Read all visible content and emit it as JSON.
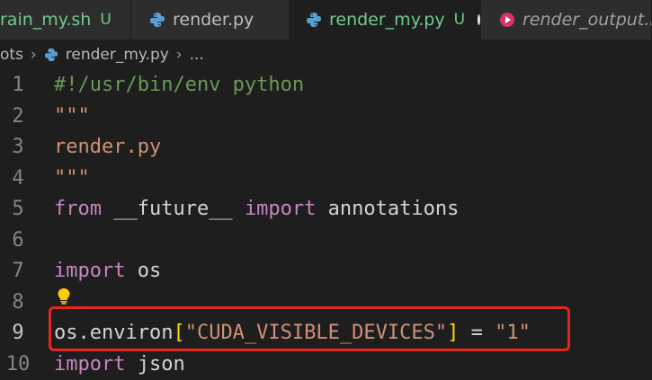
{
  "tabs": [
    {
      "label": "rain_my.sh",
      "badge": "U",
      "icon": "none",
      "state": "untracked"
    },
    {
      "label": "render.py",
      "icon": "python-icon"
    },
    {
      "label": "render_my.py",
      "badge": "U",
      "icon": "python-icon",
      "state": "active-modified"
    },
    {
      "label": "render_output.mp",
      "icon": "media-play-icon",
      "state": "preview"
    }
  ],
  "breadcrumb": {
    "parts": [
      "ots",
      "render_my.py",
      "..."
    ]
  },
  "editor": {
    "lines": [
      {
        "num": "1",
        "tokens": [
          {
            "t": "#!/usr/bin/env python",
            "k": "comment"
          }
        ]
      },
      {
        "num": "2",
        "tokens": [
          {
            "t": "\"\"\"",
            "k": "string"
          }
        ]
      },
      {
        "num": "3",
        "tokens": [
          {
            "t": "render.py",
            "k": "string"
          }
        ]
      },
      {
        "num": "4",
        "tokens": [
          {
            "t": "\"\"\"",
            "k": "string"
          }
        ]
      },
      {
        "num": "5",
        "tokens": [
          {
            "t": "from",
            "k": "kw"
          },
          {
            "t": " __future__ ",
            "k": "id"
          },
          {
            "t": "import",
            "k": "kw"
          },
          {
            "t": " annotations",
            "k": "id"
          }
        ]
      },
      {
        "num": "6",
        "tokens": []
      },
      {
        "num": "7",
        "tokens": [
          {
            "t": "import",
            "k": "kw"
          },
          {
            "t": " os",
            "k": "id"
          }
        ]
      },
      {
        "num": "8",
        "tokens": []
      },
      {
        "num": "9",
        "tokens": [
          {
            "t": "os.environ",
            "k": "id"
          },
          {
            "t": "[",
            "k": "bracket"
          },
          {
            "t": "\"CUDA_VISIBLE_DEVICES\"",
            "k": "string"
          },
          {
            "t": "]",
            "k": "bracket"
          },
          {
            "t": " = ",
            "k": "id"
          },
          {
            "t": "\"1\"",
            "k": "string"
          }
        ]
      },
      {
        "num": "10",
        "tokens": [
          {
            "t": "import",
            "k": "kw"
          },
          {
            "t": " json",
            "k": "id"
          }
        ]
      }
    ],
    "highlighted_line": "9",
    "lightbulb_icon": "lightbulb-icon"
  },
  "colors": {
    "accent_git": "#73c991",
    "highlight_box": "#e3261f",
    "string": "#ce9178",
    "keyword": "#c586c0",
    "comment": "#6a9955"
  }
}
